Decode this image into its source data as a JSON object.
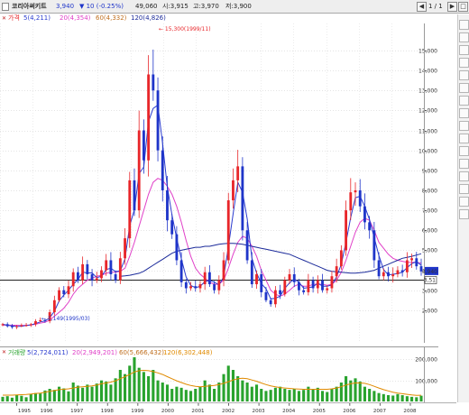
{
  "title_bar": {
    "name": "코리아써키트",
    "price": "3,940",
    "change": "▼ 10 (-0.25%)",
    "volume": "49,060",
    "open": "시:3,915",
    "high": "고:3,970",
    "low": "저:3,900",
    "page": "1 / 1",
    "buttons": [
      "◀",
      "▶",
      "□"
    ]
  },
  "price_legend": {
    "title": "가격",
    "ma5": "5(4,211)",
    "ma20": "20(4,354)",
    "ma60": "60(4,332)",
    "ma120": "120(4,826)"
  },
  "volume_legend": {
    "title": "거래량",
    "v5": "5(2,724,011)",
    "v20": "20(2,949,201)",
    "v60": "60(5,666,432)",
    "v120": "120(6,302,448)"
  },
  "annotations": {
    "high_label": "← 15,300(1999/11)",
    "low_label": "← 1,149(1995/03)"
  },
  "price_axis_box": {
    "current": "3,940",
    "ref": "3,51"
  },
  "colors": {
    "up": "#e8262a",
    "down": "#1f35c9",
    "ma5": "#2a3bcf",
    "ma20": "#e040c8",
    "ma60": "#c07020",
    "ma120": "#1b2a9a",
    "vol_bar": "#29a32e",
    "ref_line": "#222222"
  },
  "chart_data": [
    {
      "type": "candlestick",
      "title": "코리아써키트",
      "x": [
        "1995",
        "1996",
        "1997",
        "1998",
        "1999",
        "2000",
        "2001",
        "2002",
        "2003",
        "2004",
        "2005",
        "2006",
        "2007",
        "2008"
      ],
      "yticks": [
        2000,
        3000,
        4000,
        5000,
        6000,
        7000,
        8000,
        9000,
        10000,
        11000,
        12000,
        13000,
        14000,
        15000
      ],
      "ytick_labels": [
        "2,000",
        "3,000",
        "4,000",
        "5,000",
        "6,000",
        "7,000",
        "8,000",
        "9,000",
        "10,000",
        "11,000",
        "12,000",
        "13,000",
        "14,000",
        "15,000"
      ],
      "ylim": [
        1000,
        15900
      ],
      "reference_price": 3510,
      "close_series": [
        1300,
        1200,
        1150,
        1200,
        1250,
        1250,
        1300,
        1450,
        1500,
        1450,
        1900,
        2500,
        3000,
        2800,
        3200,
        3900,
        3500,
        4300,
        3800,
        3500,
        3600,
        4000,
        4500,
        3800,
        3500,
        4600,
        5600,
        8500,
        7000,
        11000,
        9500,
        13800,
        13000,
        10000,
        8000,
        6500,
        5800,
        4500,
        3400,
        3100,
        3200,
        3100,
        3300,
        3900,
        3300,
        3000,
        3500,
        4500,
        7500,
        8500,
        9200,
        6000,
        4500,
        3300,
        3800,
        2900,
        2500,
        2300,
        3000,
        2800,
        3500,
        3800,
        3400,
        3000,
        2900,
        3500,
        3100,
        3500,
        3000,
        3100,
        3700,
        4200,
        5000,
        7000,
        7900,
        8000,
        7200,
        6400,
        6000,
        4500,
        3700,
        3900,
        3700,
        3800,
        4000,
        3900,
        4500,
        4600,
        4200,
        3940
      ],
      "ma20_series": [
        1250,
        1260,
        1250,
        1250,
        1240,
        1250,
        1260,
        1300,
        1350,
        1400,
        1500,
        1700,
        1900,
        2100,
        2400,
        2800,
        3100,
        3300,
        3500,
        3600,
        3700,
        3750,
        3850,
        3900,
        3900,
        3950,
        4100,
        4700,
        5400,
        6200,
        7000,
        7800,
        8400,
        8600,
        8500,
        8200,
        7800,
        7200,
        6400,
        5500,
        4700,
        4100,
        3800,
        3600,
        3400,
        3300,
        3300,
        3500,
        4100,
        4800,
        5400,
        5700,
        5600,
        5200,
        4700,
        4000,
        3500,
        3000,
        2800,
        2700,
        2800,
        3000,
        3200,
        3300,
        3200,
        3200,
        3300,
        3300,
        3300,
        3250,
        3300,
        3500,
        3900,
        4500,
        5200,
        5900,
        6400,
        6600,
        6500,
        6000,
        5400,
        5100,
        4800,
        4600,
        4500,
        4450,
        4400,
        4400,
        4400,
        4354
      ],
      "ma120_series": [
        null,
        null,
        null,
        null,
        null,
        null,
        null,
        null,
        null,
        null,
        null,
        null,
        null,
        null,
        null,
        null,
        null,
        null,
        null,
        null,
        null,
        null,
        null,
        null,
        null,
        3700,
        3720,
        3750,
        3800,
        3850,
        3950,
        4100,
        4250,
        4400,
        4550,
        4700,
        4850,
        4950,
        5000,
        5050,
        5100,
        5150,
        5150,
        5200,
        5200,
        5250,
        5300,
        5330,
        5350,
        5350,
        5330,
        5300,
        5250,
        5200,
        5150,
        5100,
        5050,
        5000,
        4950,
        4900,
        4850,
        4800,
        4700,
        4600,
        4500,
        4400,
        4300,
        4200,
        4100,
        4000,
        3950,
        3920,
        3900,
        3880,
        3860,
        3860,
        3880,
        3900,
        3950,
        4000,
        4100,
        4200,
        4300,
        4400,
        4500,
        4600,
        4650,
        4700,
        4760,
        4826
      ],
      "annotations": [
        "15,300(1999/11)",
        "1,149(1995/03)"
      ]
    },
    {
      "type": "bar",
      "title": "거래량",
      "yticks": [
        100000,
        200000
      ],
      "ytick_labels": [
        "100,000",
        "200,000"
      ],
      "ylim": [
        0,
        240000
      ],
      "values": [
        22000,
        25000,
        18000,
        30000,
        27000,
        20000,
        35000,
        40000,
        38000,
        52000,
        60000,
        55000,
        70000,
        62000,
        48000,
        90000,
        75000,
        65000,
        80000,
        70000,
        85000,
        100000,
        95000,
        80000,
        110000,
        150000,
        130000,
        170000,
        210000,
        160000,
        140000,
        120000,
        150000,
        100000,
        90000,
        80000,
        60000,
        70000,
        65000,
        55000,
        50000,
        60000,
        70000,
        100000,
        80000,
        60000,
        90000,
        130000,
        170000,
        150000,
        120000,
        100000,
        90000,
        70000,
        80000,
        60000,
        50000,
        55000,
        65000,
        70000,
        60000,
        55000,
        60000,
        50000,
        55000,
        70000,
        60000,
        65000,
        50000,
        45000,
        60000,
        70000,
        90000,
        120000,
        100000,
        110000,
        95000,
        70000,
        60000,
        50000,
        40000,
        35000,
        30000,
        28000,
        35000,
        30000,
        25000,
        22000,
        20000,
        27240
      ],
      "ma_series": [
        30000,
        30000,
        30000,
        31000,
        32000,
        33000,
        35000,
        38000,
        40000,
        44000,
        48000,
        52000,
        56000,
        58000,
        60000,
        64000,
        68000,
        70000,
        72000,
        74000,
        78000,
        84000,
        88000,
        92000,
        98000,
        108000,
        118000,
        128000,
        140000,
        146000,
        148000,
        146000,
        142000,
        136000,
        128000,
        118000,
        108000,
        98000,
        90000,
        82000,
        76000,
        72000,
        70000,
        72000,
        74000,
        76000,
        80000,
        86000,
        94000,
        102000,
        108000,
        110000,
        108000,
        102000,
        96000,
        88000,
        80000,
        74000,
        70000,
        66000,
        64000,
        62000,
        60000,
        59000,
        58000,
        58000,
        58000,
        58000,
        58000,
        58000,
        60000,
        64000,
        70000,
        78000,
        84000,
        88000,
        88000,
        86000,
        80000,
        72000,
        64000,
        56000,
        50000,
        44000,
        40000,
        37000,
        34000,
        31000,
        29000,
        29492
      ]
    }
  ]
}
